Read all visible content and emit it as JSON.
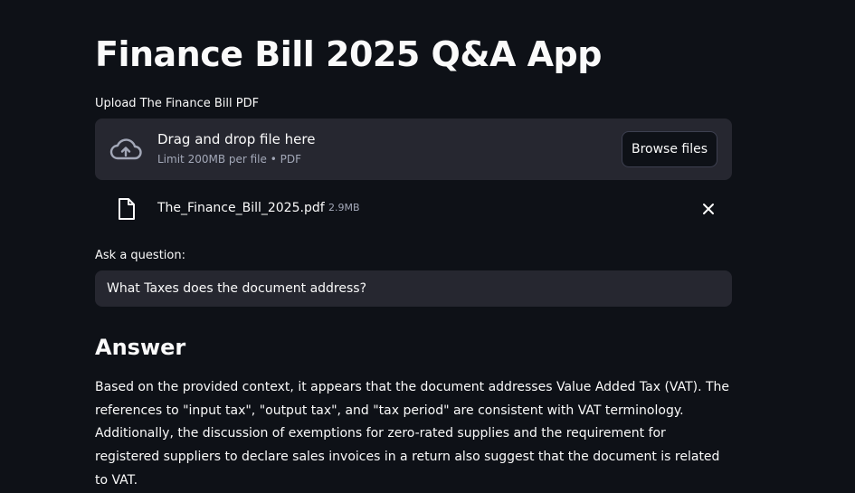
{
  "app": {
    "title": "Finance Bill 2025 Q&A App"
  },
  "uploader": {
    "label": "Upload The Finance Bill PDF",
    "drop_text": "Drag and drop file here",
    "limit_text": "Limit 200MB per file • PDF",
    "browse_button": "Browse files",
    "icon": "cloud-upload-icon"
  },
  "uploaded_file": {
    "name": "The_Finance_Bill_2025.pdf",
    "size": "2.9MB",
    "icon": "file-icon",
    "remove_icon": "close-icon"
  },
  "question": {
    "label": "Ask a question:",
    "value": "What Taxes does the document address?"
  },
  "answer": {
    "heading": "Answer",
    "text": "Based on the provided context, it appears that the document addresses Value Added Tax (VAT). The references to \"input tax\", \"output tax\", and \"tax period\" are consistent with VAT terminology. Additionally, the discussion of exemptions for zero-rated supplies and the requirement for registered suppliers to declare sales invoices in a return also suggest that the document is related to VAT."
  },
  "colors": {
    "background": "#0e1117",
    "surface": "#262730",
    "text": "#fafafa",
    "muted_text": "#a3a8b8"
  }
}
